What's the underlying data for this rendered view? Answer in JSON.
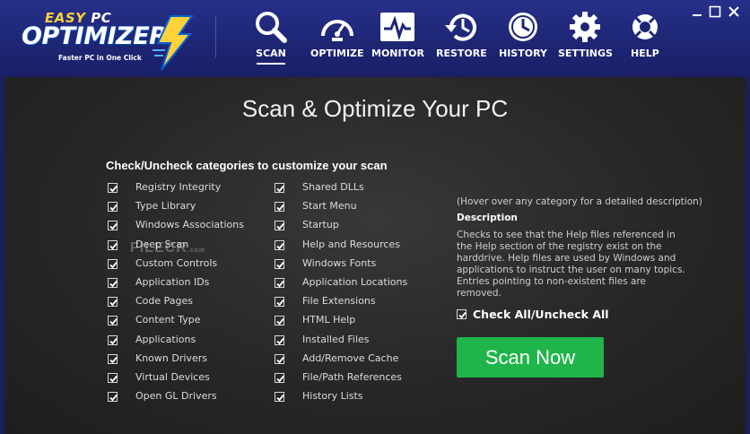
{
  "app": {
    "logo_top": "EASY",
    "logo_top_accent": "PC",
    "logo_main": "OPTIMIZER",
    "logo_tagline": "Faster PC in One Click"
  },
  "nav": {
    "items": [
      {
        "label": "SCAN",
        "icon": "magnifier-icon",
        "active": true
      },
      {
        "label": "OPTIMIZE",
        "icon": "speedometer-icon"
      },
      {
        "label": "MONITOR",
        "icon": "heartbeat-monitor-icon"
      },
      {
        "label": "RESTORE",
        "icon": "restore-clock-icon"
      },
      {
        "label": "HISTORY",
        "icon": "clock-icon"
      },
      {
        "label": "SETTINGS",
        "icon": "gear-icon"
      },
      {
        "label": "HELP",
        "icon": "lifebuoy-icon"
      }
    ]
  },
  "main": {
    "title": "Scan & Optimize Your PC",
    "instructions": "Check/Uncheck categories to customize your  scan",
    "left_categories": [
      "Registry Integrity",
      "Type Library",
      "Windows Associations",
      "Deep Scan",
      "Custom Controls",
      "Application IDs",
      "Code Pages",
      "Content Type",
      "Applications",
      "Known Drivers",
      "Virtual Devices",
      "Open GL Drivers"
    ],
    "right_categories": [
      "Shared DLLs",
      "Start Menu",
      "Startup",
      "Help and Resources",
      "Windows Fonts",
      "Application Locations",
      "File Extensions",
      "HTML Help",
      "Installed Files",
      "Add/Remove Cache",
      "File/Path References",
      "History Lists"
    ],
    "hover_hint": "(Hover over any category for a detailed description)",
    "description_title": "Description",
    "description_text": "Checks to see that the Help files referenced in the Help section of the registry exist on the harddrive. Help files are used by Windows and applications to instruct the user on many topics. Entries pointing to non-existent files are removed.",
    "check_all_label": "Check All/Uncheck All",
    "scan_button": "Scan Now",
    "watermark": "FILECR",
    "watermark_suffix": ".com"
  },
  "colors": {
    "header_bg": "#1e2675",
    "panel_bg": "#2a2a2a",
    "scan_button": "#1fb54a",
    "logo_accent": "#ffd23a"
  }
}
